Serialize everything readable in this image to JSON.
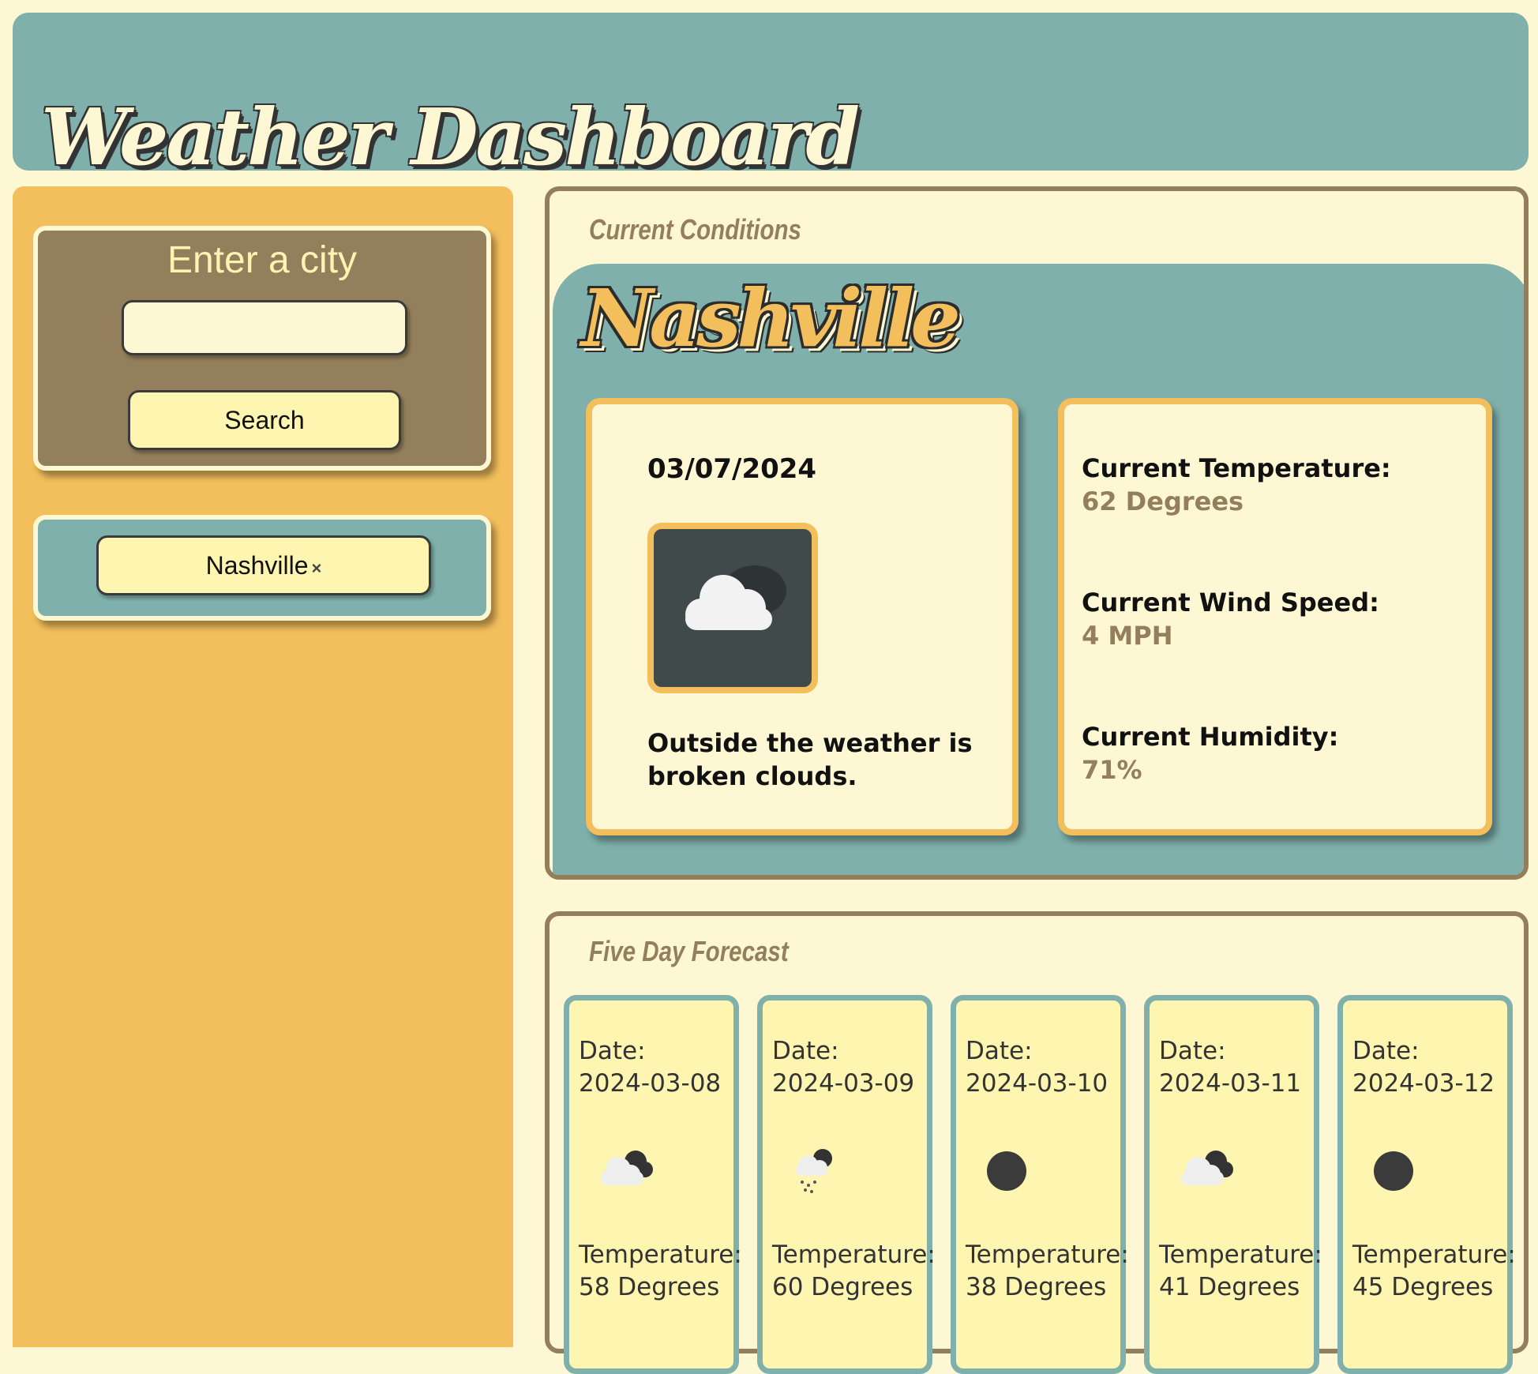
{
  "header": {
    "title": "Weather Dashboard"
  },
  "sidebar": {
    "search_title": "Enter a city",
    "input_value": "",
    "input_placeholder": "",
    "search_button": "Search",
    "history": [
      {
        "label": "Nashville",
        "remove_glyph": "×"
      }
    ]
  },
  "current": {
    "section_title": "Current Conditions",
    "city": "Nashville",
    "date": "03/07/2024",
    "icon": "broken-clouds-icon",
    "description": "Outside the weather is broken clouds.",
    "temperature_label": "Current Temperature:",
    "temperature_value": "62 Degrees",
    "wind_label": "Current Wind Speed:",
    "wind_value": "4 MPH",
    "humidity_label": "Current Humidity:",
    "humidity_value": "71%"
  },
  "forecast": {
    "section_title": "Five Day Forecast",
    "date_label": "Date:",
    "temp_label": "Temperature:",
    "days": [
      {
        "date": "2024-03-08",
        "icon": "broken-clouds-icon",
        "temp": "58 Degrees"
      },
      {
        "date": "2024-03-09",
        "icon": "rain-icon",
        "temp": "60 Degrees"
      },
      {
        "date": "2024-03-10",
        "icon": "clear-night-icon",
        "temp": "38 Degrees"
      },
      {
        "date": "2024-03-11",
        "icon": "broken-clouds-icon",
        "temp": "41 Degrees"
      },
      {
        "date": "2024-03-12",
        "icon": "clear-night-icon",
        "temp": "45 Degrees"
      }
    ]
  },
  "colors": {
    "background": "#fdf8d3",
    "teal": "#7fb0ac",
    "mustard": "#f3be5c",
    "brown": "#937f5b",
    "button": "#fef5b0"
  }
}
